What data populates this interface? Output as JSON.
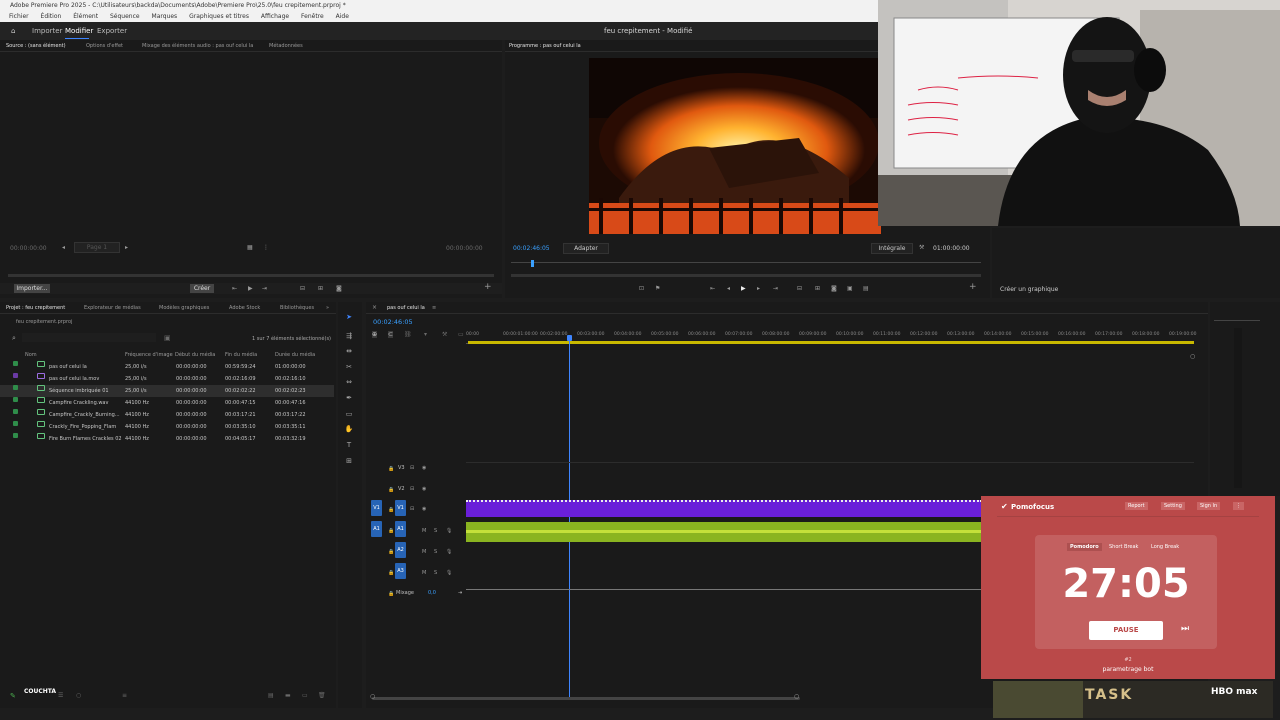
{
  "app": {
    "title": "Adobe Premiere Pro 2025 - C:\\Utilisateurs\\backda\\Documents\\Adobe\\Premiere Pro\\25.0\\feu crepitement.prproj *"
  },
  "menu": [
    "Fichier",
    "Édition",
    "Élément",
    "Séquence",
    "Marques",
    "Graphiques et titres",
    "Affichage",
    "Fenêtre",
    "Aide"
  ],
  "workspace": {
    "tabs": [
      "Importer",
      "Modifier",
      "Exporter"
    ],
    "active": "Modifier",
    "doc_title": "feu crepitement - Modifié"
  },
  "source": {
    "tabs": [
      "Source : (sans élément)",
      "Options d'effet",
      "Mixage des éléments audio : pas ouf celui la",
      "Métadonnées"
    ],
    "tc_left": "00:00:00:00",
    "tc_right": "00:00:00:00",
    "page": "Page 1",
    "import": "Importer...",
    "btn": "Créer"
  },
  "program": {
    "tab": "Programme : pas ouf celui la",
    "tc": "00:02:46:05",
    "fit": "Adapter",
    "quality": "Intégrale",
    "tc_right": "01:00:00:00",
    "graph": "Créer un graphique"
  },
  "project": {
    "tabs": [
      "Projet : feu crepitement",
      "Explorateur de médias",
      "Modèles graphiques",
      "Adobe Stock",
      "Bibliothèques"
    ],
    "file": "feu crepitement.prproj",
    "selection": "1 sur 7 éléments sélectionné(s)",
    "columns": [
      "Nom",
      "Fréquence d'image",
      "Début du média",
      "Fin du média",
      "Durée du média"
    ],
    "rows": [
      {
        "name": "pas ouf celui la",
        "rate": "25,00 i/s",
        "start": "00:00:00:00",
        "end": "00:59:59:24",
        "dur": "01:00:00:00",
        "color": "#2f8d4a",
        "type": "seq"
      },
      {
        "name": "pas ouf celui la.mov",
        "rate": "25,00 i/s",
        "start": "00:00:00:00",
        "end": "00:02:16:09",
        "dur": "00:02:16:10",
        "color": "#6a3aa5",
        "type": "vid"
      },
      {
        "name": "Séquence imbriquée 01",
        "rate": "25,00 i/s",
        "start": "00:00:00:00",
        "end": "00:02:02:22",
        "dur": "00:02:02:23",
        "color": "#2f8d4a",
        "type": "seq"
      },
      {
        "name": "Campfire Crackling.wav",
        "rate": "44100  Hz",
        "start": "00:00:00:00",
        "end": "00:00:47:15",
        "dur": "00:00:47:16",
        "color": "#2f8d4a",
        "type": "aud"
      },
      {
        "name": "Campfire_Crackly_Burning...",
        "rate": "44100  Hz",
        "start": "00:00:00:00",
        "end": "00:03:17:21",
        "dur": "00:03:17:22",
        "color": "#2f8d4a",
        "type": "aud"
      },
      {
        "name": "Crackly_Fire_Popping_Flam",
        "rate": "44100  Hz",
        "start": "00:00:00:00",
        "end": "00:03:35:10",
        "dur": "00:03:35:11",
        "color": "#2f8d4a",
        "type": "aud"
      },
      {
        "name": "Fire Burn Flames Crackles 02",
        "rate": "44100  Hz",
        "start": "00:00:00:00",
        "end": "00:04:05:17",
        "dur": "00:03:32:19",
        "color": "#2f8d4a",
        "type": "aud"
      }
    ]
  },
  "timeline": {
    "tab": "pas ouf celui la",
    "tc": "00:02:46:05",
    "ruler": [
      "00:00",
      "00:00:01:00:00",
      "00:02:00:00",
      "00:03:00:00",
      "00:04:00:00",
      "00:05:00:00",
      "00:06:00:00",
      "00:07:00:00",
      "00:08:00:00",
      "00:09:00:00",
      "00:10:00:00",
      "00:11:00:00",
      "00:12:00:00",
      "00:13:00:00",
      "00:14:00:00",
      "00:15:00:00",
      "00:16:00:00",
      "00:17:00:00",
      "00:18:00:00",
      "00:19:00:00"
    ],
    "tracks": {
      "v3": "V3",
      "v2": "V2",
      "v1": "V1",
      "a1": "A1",
      "a2": "A2",
      "a3": "A3",
      "mix": "Mixage",
      "mixval": "0,0"
    }
  },
  "pomofocus": {
    "brand": "Pomofocus",
    "report": "Report",
    "setting": "Setting",
    "signin": "Sign In",
    "modes": [
      "Pomodoro",
      "Short Break",
      "Long Break"
    ],
    "time": "27:05",
    "pause": "PAUSE",
    "count": "#2",
    "task": "parametrage bot"
  },
  "overlay": {
    "banner": "TASK",
    "banner_brand": "HBO max",
    "logo": "COUCHTA"
  }
}
